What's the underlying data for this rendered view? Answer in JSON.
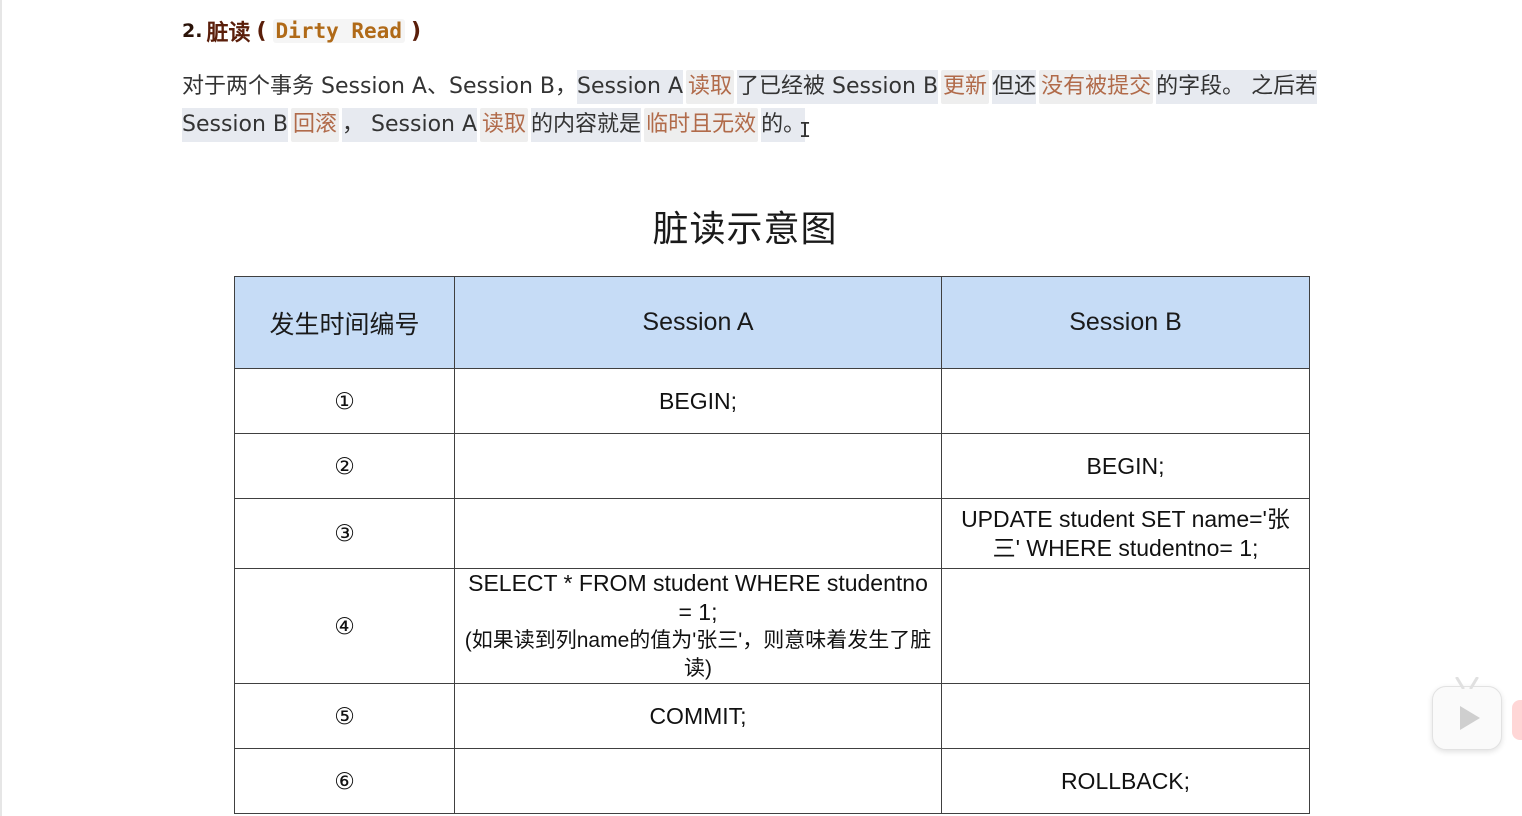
{
  "heading": {
    "number": "2.",
    "title_cn": "脏读",
    "paren_open": "(",
    "title_en": "Dirty Read",
    "paren_close": ")"
  },
  "paragraph": {
    "line1": {
      "p1": "对于两个事务 Session A、Session B，",
      "p2": "Session A",
      "k1": "读取",
      "p3": "了已经被 Session B",
      "k2": "更新",
      "p4": "但还",
      "k3": "没有被提交",
      "p5": "的字段。 之后若"
    },
    "line2": {
      "p1": "Session B",
      "k1": "回滚",
      "p2": "， Session A",
      "k2": "读取",
      "p3": "的内容就是",
      "k3": "临时且无效",
      "p4": "的。"
    }
  },
  "diagram": {
    "title": "脏读示意图",
    "headers": [
      "发生时间编号",
      "Session A",
      "Session B"
    ],
    "rows": [
      {
        "step": "①",
        "a": "BEGIN;",
        "b": ""
      },
      {
        "step": "②",
        "a": "",
        "b": "BEGIN;"
      },
      {
        "step": "③",
        "a": "",
        "b": "UPDATE student SET name='张三' WHERE studentno= 1;"
      },
      {
        "step": "④",
        "a": "SELECT * FROM student WHERE studentno = 1;",
        "a_note": "(如果读到列name的值为'张三'，则意味着发生了脏读)",
        "b": ""
      },
      {
        "step": "⑤",
        "a": "COMMIT;",
        "b": ""
      },
      {
        "step": "⑥",
        "a": "",
        "b": "ROLLBACK;"
      }
    ]
  },
  "icons": {
    "text_cursor": "text-cursor-icon",
    "video_play": "play-icon"
  }
}
